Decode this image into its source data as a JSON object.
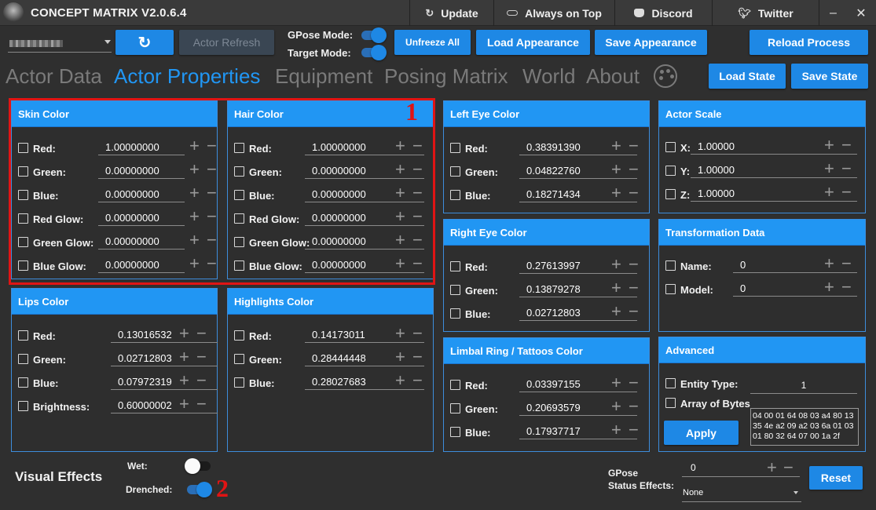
{
  "app": {
    "title": "CONCEPT MATRIX V2.0.6.4"
  },
  "titlebar": {
    "update": "Update",
    "always_on_top": "Always on Top",
    "discord": "Discord",
    "twitter": "Twitter",
    "minimize": "–",
    "close": "✕"
  },
  "toolbar": {
    "actor_refresh": "Actor Refresh",
    "gpose_mode": "GPose Mode:",
    "target_mode": "Target Mode:",
    "unfreeze_all": "Unfreeze All",
    "load_appearance": "Load Appearance",
    "save_appearance": "Save Appearance",
    "reload_process": "Reload Process",
    "load_state": "Load State",
    "save_state": "Save State"
  },
  "tabs": [
    "Actor Data",
    "Actor Properties",
    "Equipment",
    "Posing Matrix",
    "World",
    "About"
  ],
  "active_tab": "Actor Properties",
  "skin_color": {
    "title": "Skin Color",
    "rows": [
      {
        "label": "Red:",
        "value": "1.00000000"
      },
      {
        "label": "Green:",
        "value": "0.00000000"
      },
      {
        "label": "Blue:",
        "value": "0.00000000"
      },
      {
        "label": "Red Glow:",
        "value": "0.00000000"
      },
      {
        "label": "Green Glow:",
        "value": "0.00000000"
      },
      {
        "label": "Blue Glow:",
        "value": "0.00000000"
      }
    ]
  },
  "hair_color": {
    "title": "Hair Color",
    "rows": [
      {
        "label": "Red:",
        "value": "1.00000000"
      },
      {
        "label": "Green:",
        "value": "0.00000000"
      },
      {
        "label": "Blue:",
        "value": "0.00000000"
      },
      {
        "label": "Red Glow:",
        "value": "0.00000000"
      },
      {
        "label": "Green Glow:",
        "value": "0.00000000"
      },
      {
        "label": "Blue Glow:",
        "value": "0.00000000"
      }
    ]
  },
  "left_eye_color": {
    "title": "Left Eye Color",
    "rows": [
      {
        "label": "Red:",
        "value": "0.38391390"
      },
      {
        "label": "Green:",
        "value": "0.04822760"
      },
      {
        "label": "Blue:",
        "value": "0.18271434"
      }
    ]
  },
  "right_eye_color": {
    "title": "Right Eye Color",
    "rows": [
      {
        "label": "Red:",
        "value": "0.27613997"
      },
      {
        "label": "Green:",
        "value": "0.13879278"
      },
      {
        "label": "Blue:",
        "value": "0.02712803"
      }
    ]
  },
  "limbal_ring": {
    "title": "Limbal Ring / Tattoos Color",
    "rows": [
      {
        "label": "Red:",
        "value": "0.03397155"
      },
      {
        "label": "Green:",
        "value": "0.20693579"
      },
      {
        "label": "Blue:",
        "value": "0.17937717"
      }
    ]
  },
  "lips_color": {
    "title": "Lips Color",
    "rows": [
      {
        "label": "Red:",
        "value": "0.13016532"
      },
      {
        "label": "Green:",
        "value": "0.02712803"
      },
      {
        "label": "Blue:",
        "value": "0.07972319"
      },
      {
        "label": "Brightness:",
        "value": "0.60000002"
      }
    ]
  },
  "highlights_color": {
    "title": "Highlights Color",
    "rows": [
      {
        "label": "Red:",
        "value": "0.14173011"
      },
      {
        "label": "Green:",
        "value": "0.28444448"
      },
      {
        "label": "Blue:",
        "value": "0.28027683"
      }
    ]
  },
  "actor_scale": {
    "title": "Actor Scale",
    "rows": [
      {
        "label": "X:",
        "value": "1.00000"
      },
      {
        "label": "Y:",
        "value": "1.00000"
      },
      {
        "label": "Z:",
        "value": "1.00000"
      }
    ]
  },
  "transformation": {
    "title": "Transformation Data",
    "rows": [
      {
        "label": "Name:",
        "value": "0"
      },
      {
        "label": "Model:",
        "value": "0"
      }
    ]
  },
  "advanced": {
    "title": "Advanced",
    "entity_type_label": "Entity Type:",
    "entity_type_value": "1",
    "array_label": "Array of Bytes",
    "bytes": "04 00 01 64 08 03 a4 80 13 35 4e a2 09 a2 03 6a 01 03 01 80 32 64 07 00 1a 2f",
    "apply": "Apply"
  },
  "visual_effects": {
    "title": "Visual Effects",
    "wet": "Wet:",
    "drenched": "Drenched:"
  },
  "gpose_status": {
    "label_line1": "GPose",
    "label_line2": "Status Effects:",
    "value": "0",
    "dropdown": "None",
    "reset": "Reset"
  },
  "annotations": {
    "one": "1",
    "two": "2"
  },
  "colors": {
    "accent": "#2196f3",
    "highlight": "#e01414",
    "background": "#2f2f2f"
  }
}
